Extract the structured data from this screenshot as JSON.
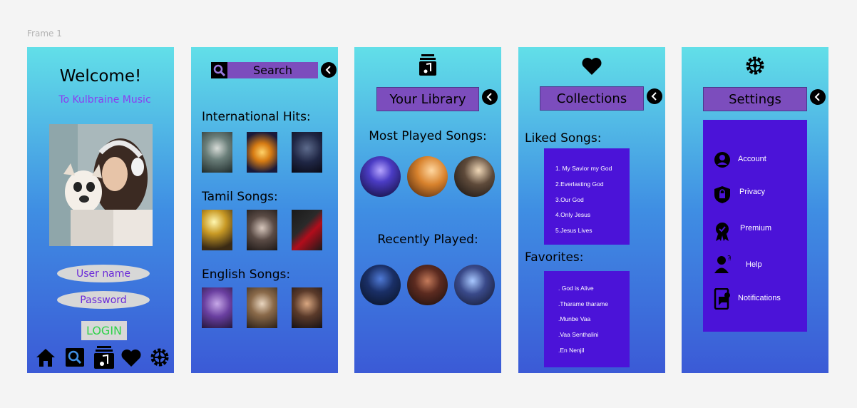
{
  "frame_label": "Frame 1",
  "login": {
    "welcome": "Welcome!",
    "subtitle": "To Kulbraine Music",
    "username_placeholder": "User name",
    "password_placeholder": "Password",
    "login_button": "LOGIN",
    "nav_icons": [
      "home-icon",
      "search-icon",
      "library-icon",
      "heart-icon",
      "settings-icon"
    ]
  },
  "search": {
    "search_label": "Search",
    "sections": [
      {
        "title": "International Hits:"
      },
      {
        "title": "Tamil Songs:"
      },
      {
        "title": "English Songs:"
      }
    ]
  },
  "library": {
    "title": "Your Library",
    "most_played": "Most Played Songs:",
    "recently_played": "Recently Played:"
  },
  "collections": {
    "title": "Collections",
    "liked_heading": "Liked Songs:",
    "liked_songs": [
      "1. My Savior my God",
      "2.Everlasting God",
      "3.Our God",
      "4.Only Jesus",
      "5.Jesus Lives"
    ],
    "favorites_heading": "Favorites:",
    "favorites": [
      ". God is Alive",
      ".Tharame tharame",
      ".Munbe Vaa",
      ".Vaa Senthalini",
      ".En Nenjil"
    ]
  },
  "settings": {
    "title": "Settings",
    "items": [
      "Account",
      "Privacy",
      "Premium",
      "Help",
      "Notifications"
    ]
  },
  "colors": {
    "gradient_top": "#62dfe8",
    "gradient_bottom": "#3b5ad6",
    "title_box": "#7c4dbd",
    "list_box": "#4b13d8",
    "subtitle": "#8a3ff0",
    "login_text": "#2fd24a"
  }
}
